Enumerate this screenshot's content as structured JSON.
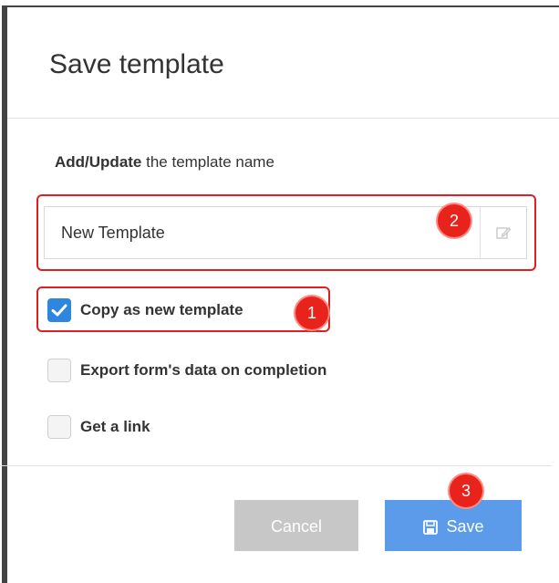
{
  "dialog": {
    "title": "Save template",
    "name_label_bold": "Add/Update",
    "name_label_rest": " the template name",
    "name_value": "New Template"
  },
  "options": [
    {
      "label": "Copy as new template",
      "checked": true
    },
    {
      "label": "Export form's data on completion",
      "checked": false
    },
    {
      "label": "Get a link",
      "checked": false
    }
  ],
  "buttons": {
    "cancel_label": "Cancel",
    "save_label": "Save"
  },
  "callouts": [
    "1",
    "2",
    "3"
  ],
  "colors": {
    "accent": "#2e86de",
    "save_button": "#5b9bea",
    "cancel_button": "#c7c7c7",
    "callout": "#e8231b"
  }
}
